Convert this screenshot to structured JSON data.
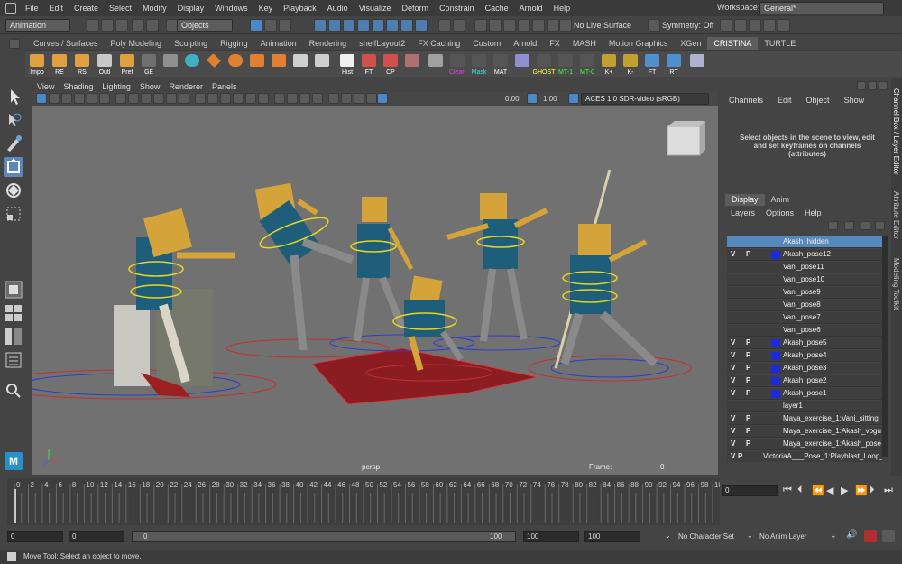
{
  "menubar": {
    "items": [
      "File",
      "Edit",
      "Create",
      "Select",
      "Modify",
      "Display",
      "Windows",
      "Key",
      "Playback",
      "Audio",
      "Visualize",
      "Deform",
      "Constrain",
      "Cache",
      "Arnold",
      "Help"
    ],
    "workspace_label": "Workspace:",
    "workspace_value": "General*"
  },
  "statusline": {
    "menuset": "Animation",
    "selection_mode": "Objects",
    "live_surface": "No Live Surface",
    "symmetry": "Symmetry: Off"
  },
  "shelf": {
    "tabs": [
      "Curves / Surfaces",
      "Poly Modeling",
      "Sculpting",
      "Rigging",
      "Animation",
      "Rendering",
      "shelfLayout2",
      "FX Caching",
      "Custom",
      "Arnold",
      "FX",
      "MASH",
      "Motion Graphics",
      "XGen",
      "CRISTINA",
      "TURTLE"
    ],
    "active_tab": "CRISTINA",
    "buttons": [
      {
        "label": "Impo",
        "icon": "folder-icon",
        "color": "#e0a040"
      },
      {
        "label": "RE",
        "icon": "folder-icon",
        "color": "#e0a040"
      },
      {
        "label": "RS",
        "icon": "folder-icon",
        "color": "#e0a040"
      },
      {
        "label": "Outl",
        "icon": "outliner-icon",
        "color": "#c8c8c8"
      },
      {
        "label": "Pref",
        "icon": "folder-icon",
        "color": "#e0a040"
      },
      {
        "label": "GE",
        "icon": "graph-editor-icon",
        "color": "#909090"
      },
      {
        "label": "Hist",
        "icon": "history-icon",
        "color": "#f0f0f0"
      },
      {
        "label": "FT",
        "icon": "freeze-transform-icon",
        "color": "#d05050"
      },
      {
        "label": "CP",
        "icon": "center-pivot-icon",
        "color": "#d05050"
      },
      {
        "label": "Clean",
        "icon": "mel-icon",
        "color": "#e040e0"
      },
      {
        "label": "Mask",
        "icon": "mel-icon",
        "color": "#40e0e0"
      },
      {
        "label": "MAT",
        "icon": "mel-icon",
        "color": "#f0f0f0"
      },
      {
        "label": "GHOST",
        "icon": "mel-icon",
        "color": "#ffff40"
      },
      {
        "label": "MT-1",
        "icon": "mel-icon",
        "color": "#40ff40"
      },
      {
        "label": "MT-0",
        "icon": "mel-icon",
        "color": "#40ff40"
      },
      {
        "label": "K+",
        "icon": "key-plus-icon",
        "color": "#f0f040"
      },
      {
        "label": "K-",
        "icon": "key-minus-icon",
        "color": "#f0f040"
      },
      {
        "label": "FT",
        "icon": "freeze-transform-icon",
        "color": "#50a0f0"
      },
      {
        "label": "RT",
        "icon": "reset-transform-icon",
        "color": "#50a0f0"
      }
    ]
  },
  "viewport": {
    "menu": [
      "View",
      "Shading",
      "Lighting",
      "Show",
      "Renderer",
      "Panels"
    ],
    "exposure": "0.00",
    "gamma": "1.00",
    "color_space": "ACES 1.0 SDR-video (sRGB)",
    "camera": "persp",
    "frame_label": "Frame:",
    "frame_value": "0"
  },
  "channel_box": {
    "menu": [
      "Channels",
      "Edit",
      "Object",
      "Show"
    ],
    "message": "Select objects in the scene to view, edit and set keyframes on channels (attributes)"
  },
  "layer_editor": {
    "tabs": [
      "Display",
      "Anim"
    ],
    "active_tab": "Display",
    "menu": [
      "Layers",
      "Options",
      "Help"
    ],
    "layers": [
      {
        "v": "",
        "p": "",
        "name": "Akash_hidden",
        "color": "",
        "selected": true
      },
      {
        "v": "V",
        "p": "P",
        "name": "Akash_pose12",
        "color": "#1a2adc",
        "selected": false
      },
      {
        "v": "",
        "p": "",
        "name": "Vani_pose11",
        "color": "",
        "selected": false
      },
      {
        "v": "",
        "p": "",
        "name": "Vani_pose10",
        "color": "",
        "selected": false
      },
      {
        "v": "",
        "p": "",
        "name": "Vani_pose9",
        "color": "",
        "selected": false
      },
      {
        "v": "",
        "p": "",
        "name": "Vani_pose8",
        "color": "",
        "selected": false
      },
      {
        "v": "",
        "p": "",
        "name": "Vani_pose7",
        "color": "",
        "selected": false
      },
      {
        "v": "",
        "p": "",
        "name": "Vani_pose6",
        "color": "",
        "selected": false
      },
      {
        "v": "V",
        "p": "P",
        "name": "Akash_pose5",
        "color": "#1a2adc",
        "selected": false
      },
      {
        "v": "V",
        "p": "P",
        "name": "Akash_pose4",
        "color": "#1a2adc",
        "selected": false
      },
      {
        "v": "V",
        "p": "P",
        "name": "Akash_pose3",
        "color": "#1a2adc",
        "selected": false
      },
      {
        "v": "V",
        "p": "P",
        "name": "Akash_pose2",
        "color": "#1a2adc",
        "selected": false
      },
      {
        "v": "V",
        "p": "P",
        "name": "Akash_pose1",
        "color": "#1a2adc",
        "selected": false
      },
      {
        "v": "",
        "p": "",
        "name": "layer1",
        "color": "",
        "selected": false
      },
      {
        "v": "V",
        "p": "P",
        "name": "Maya_exercise_1:Vani_sitting",
        "color": "",
        "selected": false
      },
      {
        "v": "V",
        "p": "P",
        "name": "Maya_exercise_1:Akash_vogu",
        "color": "",
        "selected": false
      },
      {
        "v": "V",
        "p": "P",
        "name": "Maya_exercise_1:Akash_pose",
        "color": "",
        "selected": false
      },
      {
        "v": "V",
        "p": "P",
        "name": "VictoriaA___Pose_1:Playblast_Loop_",
        "color": "",
        "selected": false
      }
    ]
  },
  "side_tabs": [
    "Channel Box / Layer Editor",
    "Attribute Editor",
    "Modeling Toolkit"
  ],
  "timeslider": {
    "ticks": [
      "0",
      "2",
      "4",
      "6",
      "8",
      "10",
      "12",
      "14",
      "16",
      "18",
      "20",
      "22",
      "24",
      "26",
      "28",
      "30",
      "32",
      "34",
      "36",
      "38",
      "40",
      "42",
      "44",
      "46",
      "48",
      "50",
      "52",
      "54",
      "56",
      "58",
      "60",
      "62",
      "64",
      "66",
      "68",
      "70",
      "72",
      "74",
      "76",
      "78",
      "80",
      "82",
      "84",
      "86",
      "88",
      "90",
      "92",
      "94",
      "96",
      "98",
      "100"
    ],
    "current_frame": "0"
  },
  "range": {
    "start": "0",
    "playback_start": "0",
    "slider_start": "0",
    "slider_end": "100",
    "playback_end": "100",
    "end": "100",
    "character_set": "No Character Set",
    "anim_layer": "No Anim Layer"
  },
  "helpline": {
    "text": "Move Tool: Select an object to move."
  },
  "colors": {
    "accent": "#5588bb",
    "layer_blue": "#1a2adc",
    "viewport_bg": "#717171"
  }
}
